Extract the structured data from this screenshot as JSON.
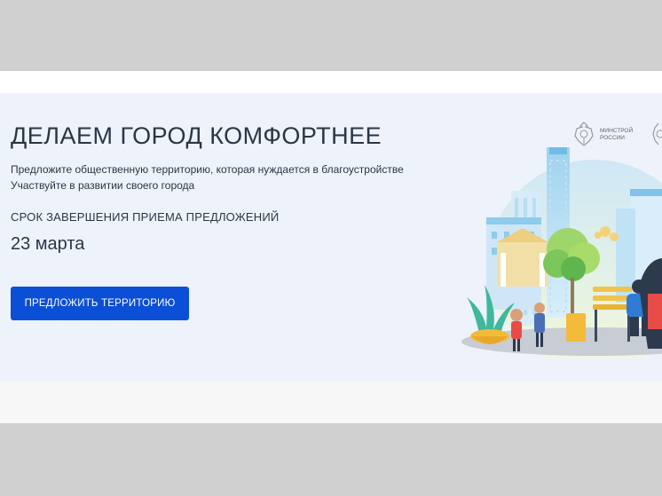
{
  "banner": {
    "title": "ДЕЛАЕМ ГОРОД КОМФОРТНЕЕ",
    "subtitle_line1": "Предложите общественную территорию, которая нуждается в благоустройстве",
    "subtitle_line2": "Участвуйте в развитии своего города",
    "deadline_label": "СРОК ЗАВЕРШЕНИЯ ПРИЕМА ПРЕДЛОЖЕНИЙ",
    "deadline_date": "23 марта",
    "cta_label": "ПРЕДЛОЖИТЬ ТЕРРИТОРИЮ"
  },
  "logo": {
    "line1": "МИНСТРОЙ",
    "line2": "РОССИИ"
  },
  "colors": {
    "banner_bg": "#eef2fb",
    "cta_bg": "#0b4fd6",
    "text": "#2b3645"
  }
}
